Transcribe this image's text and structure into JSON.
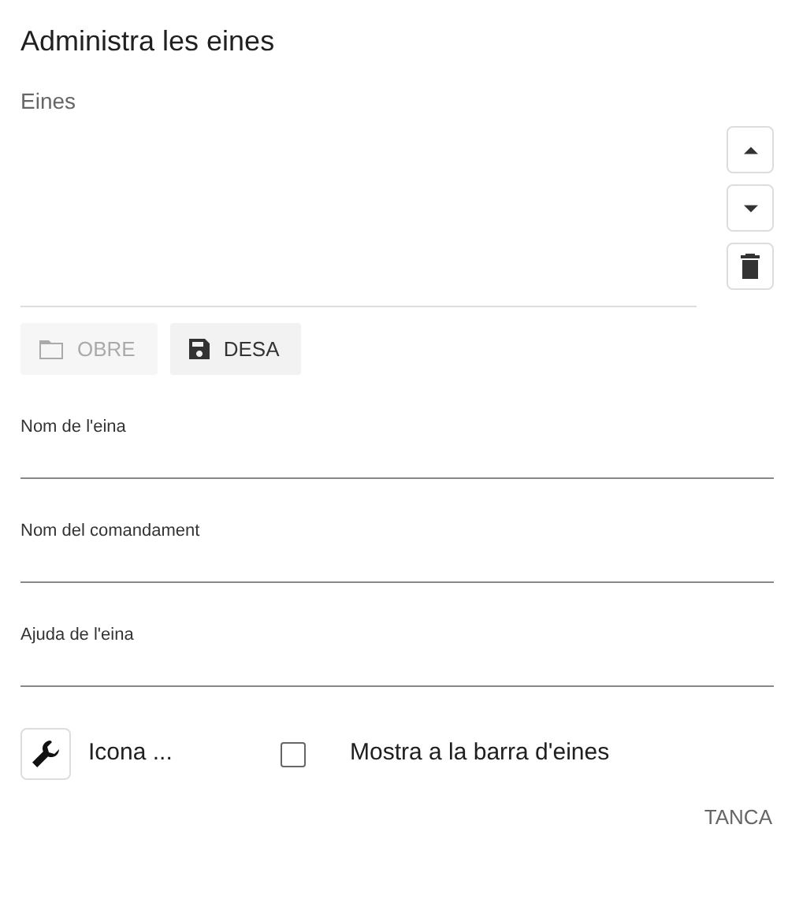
{
  "title": "Administra les eines",
  "tool_list": {
    "label": "Eines",
    "buttons": [
      {
        "kind": "up",
        "disabled": false
      },
      {
        "kind": "down",
        "disabled": false
      },
      {
        "kind": "delete",
        "disabled": false
      }
    ]
  },
  "file_buttons": [
    {
      "kind": "open",
      "label": "OBRE",
      "disabled": true
    },
    {
      "kind": "save",
      "label": "DESA",
      "disabled": false
    }
  ],
  "fields": [
    {
      "label": "Nom de l'eina"
    },
    {
      "label": "Nom del comandament"
    },
    {
      "label": "Ajuda de l'eina"
    }
  ],
  "icon_picker": {
    "label": "Icona ..."
  },
  "toolbar_checkbox": {
    "label": "Mostra a la barra d'eines",
    "checked": false
  },
  "close_button": "TANCA"
}
